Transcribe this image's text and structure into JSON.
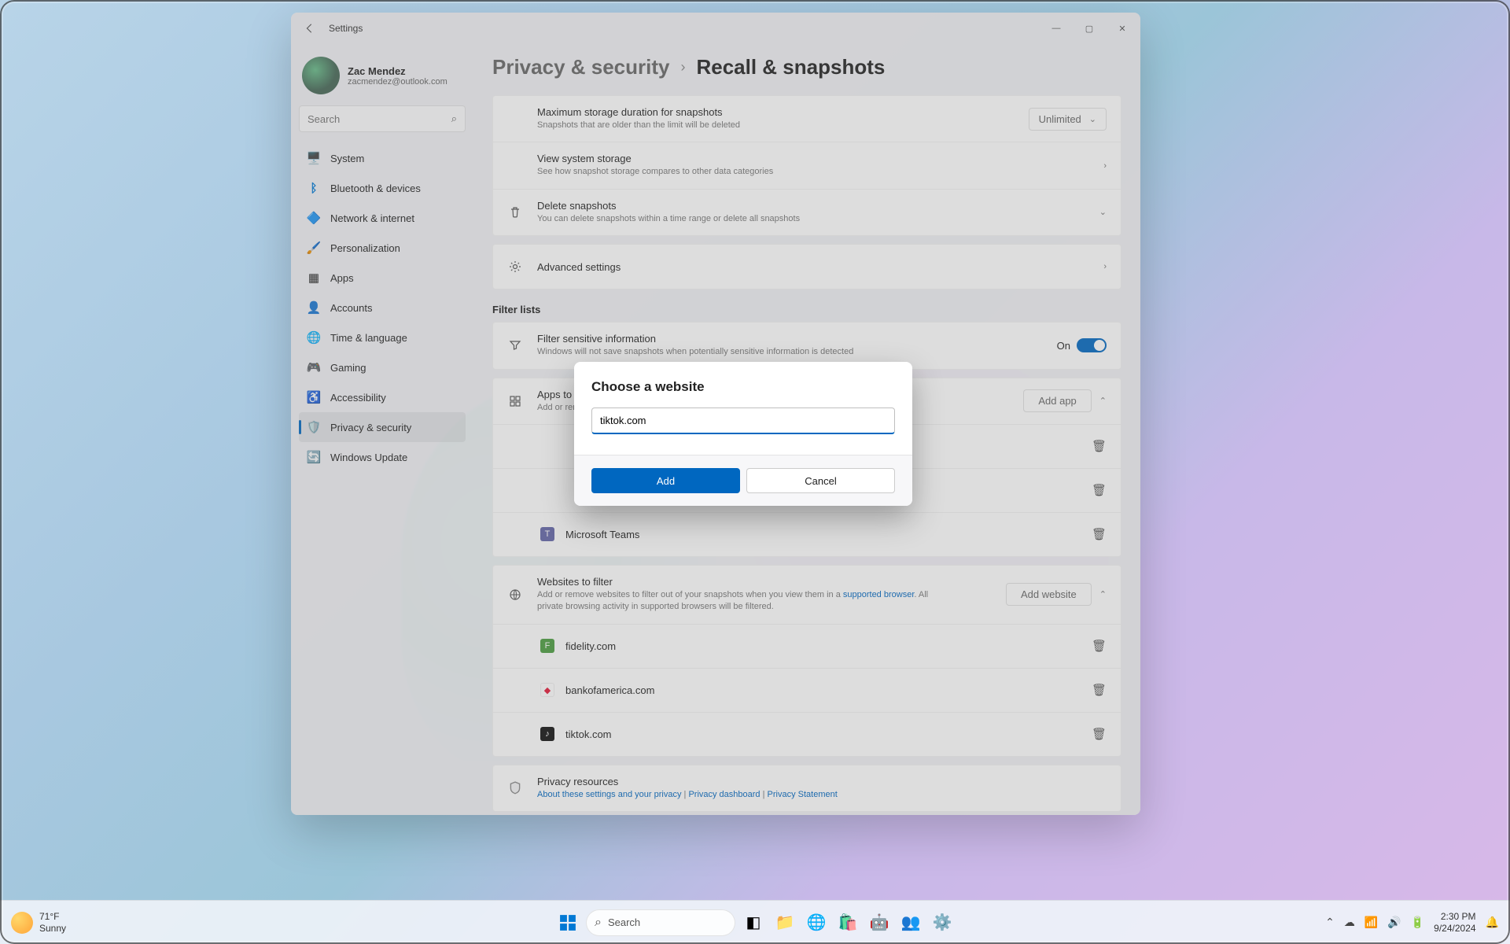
{
  "window": {
    "title": "Settings"
  },
  "profile": {
    "name": "Zac Mendez",
    "email": "zacmendez@outlook.com"
  },
  "search": {
    "placeholder": "Search"
  },
  "nav": [
    {
      "label": "System",
      "icon": "🖥️"
    },
    {
      "label": "Bluetooth & devices",
      "icon": "ᛒ"
    },
    {
      "label": "Network & internet",
      "icon": "🔷"
    },
    {
      "label": "Personalization",
      "icon": "🖌️"
    },
    {
      "label": "Apps",
      "icon": "▦"
    },
    {
      "label": "Accounts",
      "icon": "👤"
    },
    {
      "label": "Time & language",
      "icon": "🌐"
    },
    {
      "label": "Gaming",
      "icon": "🎮"
    },
    {
      "label": "Accessibility",
      "icon": "♿"
    },
    {
      "label": "Privacy & security",
      "icon": "🛡️"
    },
    {
      "label": "Windows Update",
      "icon": "🔄"
    }
  ],
  "breadcrumb": {
    "parent": "Privacy & security",
    "current": "Recall & snapshots"
  },
  "storage": {
    "max_title": "Maximum storage duration for snapshots",
    "max_sub": "Snapshots that are older than the limit will be deleted",
    "max_value": "Unlimited",
    "view_title": "View system storage",
    "view_sub": "See how snapshot storage compares to other data categories",
    "del_title": "Delete snapshots",
    "del_sub": "You can delete snapshots within a time range or delete all snapshots"
  },
  "advanced": {
    "title": "Advanced settings"
  },
  "filter_section": "Filter lists",
  "filter_sense": {
    "title": "Filter sensitive information",
    "sub": "Windows will not save snapshots when potentially sensitive information is detected",
    "state": "On"
  },
  "apps_filter": {
    "title": "Apps to filter",
    "sub": "Add or remove apps to filter out of your snapshots",
    "add": "Add app",
    "items": [
      {
        "name": "Microsoft Teams",
        "color": "#6264a7"
      }
    ]
  },
  "sites_filter": {
    "title": "Websites to filter",
    "sub_pre": "Add or remove websites to filter out of your snapshots when you view them in a ",
    "sub_link": "supported browser",
    "sub_post": ". All private browsing activity in supported browsers will be filtered.",
    "add": "Add website",
    "items": [
      {
        "name": "fidelity.com",
        "color": "#4a9d3f"
      },
      {
        "name": "bankofamerica.com",
        "color": "#e31837"
      },
      {
        "name": "tiktok.com",
        "color": "#111111"
      }
    ]
  },
  "privacy_res": {
    "title": "Privacy resources",
    "links": [
      "About these settings and your privacy",
      "Privacy dashboard",
      "Privacy Statement"
    ],
    "sep": " | "
  },
  "modal": {
    "title": "Choose a website",
    "value": "tiktok.com",
    "add": "Add",
    "cancel": "Cancel"
  },
  "taskbar": {
    "weather_temp": "71°F",
    "weather_cond": "Sunny",
    "search": "Search",
    "time": "2:30 PM",
    "date": "9/24/2024"
  }
}
